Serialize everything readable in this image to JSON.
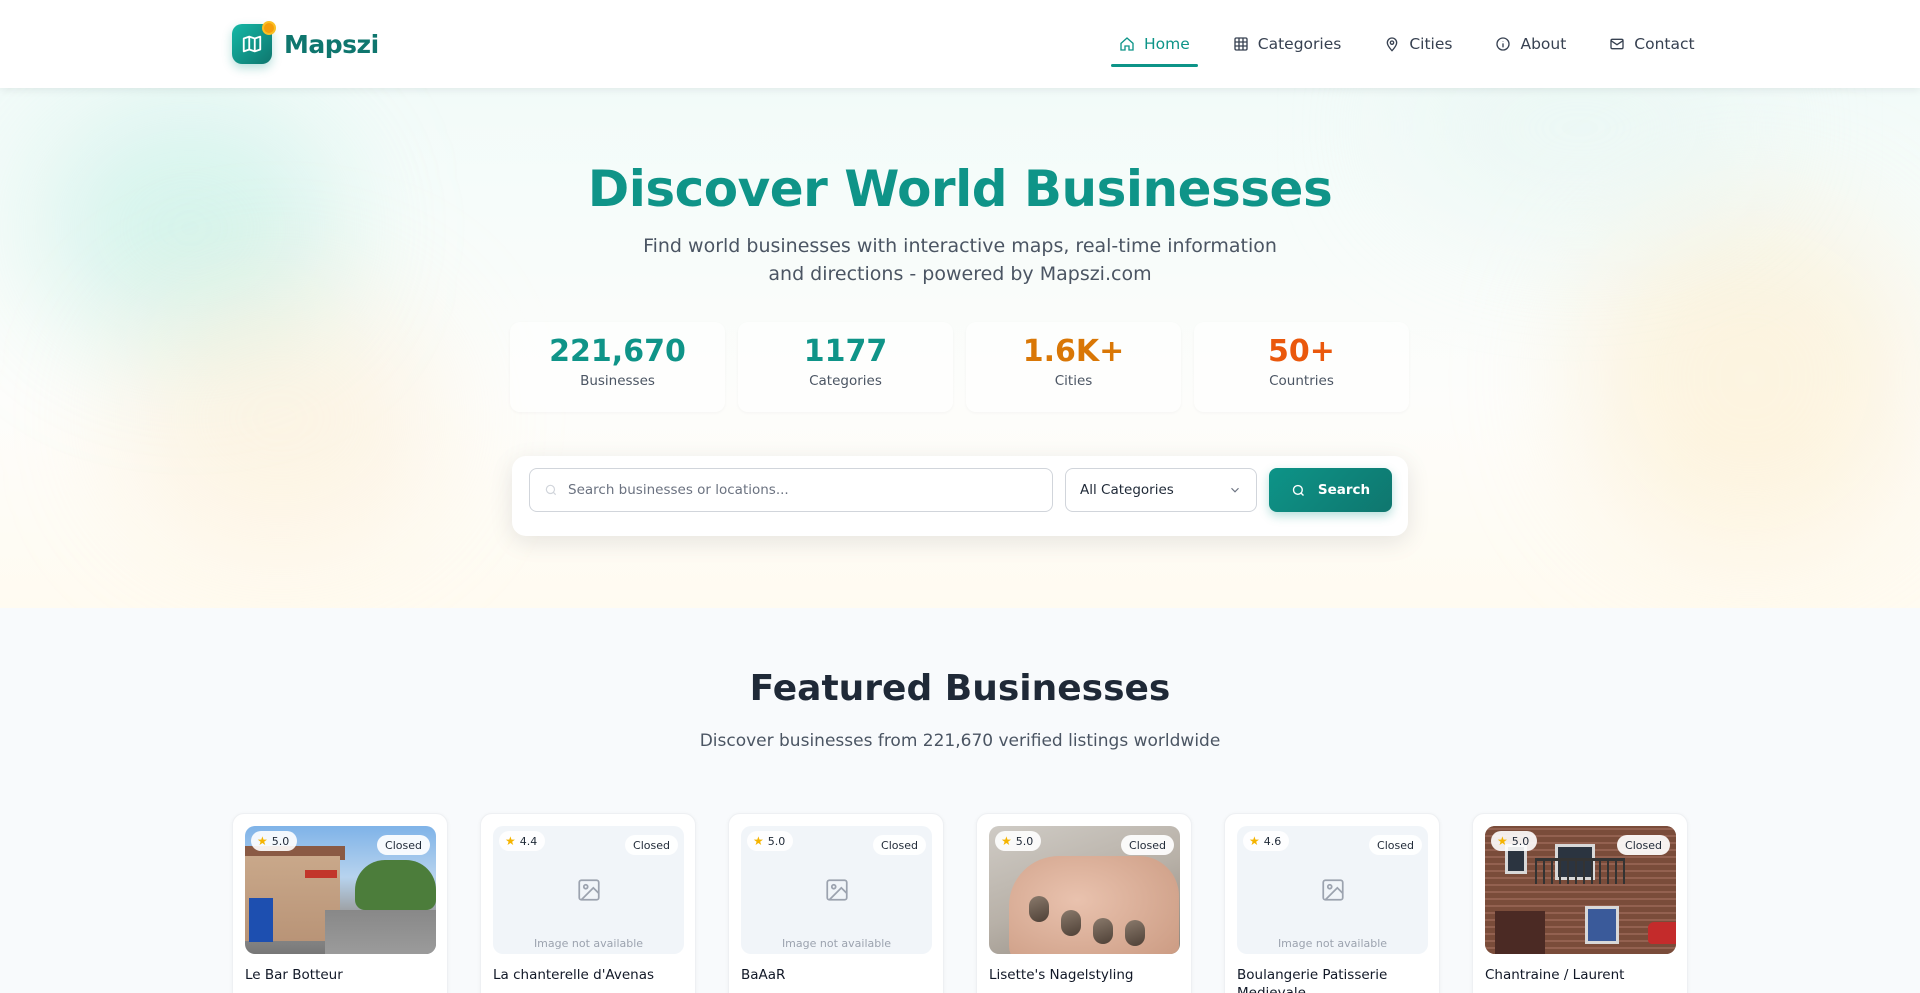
{
  "app": {
    "name": "Mapszi"
  },
  "nav": [
    {
      "label": "Home",
      "icon": "home-icon",
      "active": true
    },
    {
      "label": "Categories",
      "icon": "grid-icon",
      "active": false
    },
    {
      "label": "Cities",
      "icon": "map-pin-icon",
      "active": false
    },
    {
      "label": "About",
      "icon": "info-icon",
      "active": false
    },
    {
      "label": "Contact",
      "icon": "mail-icon",
      "active": false
    }
  ],
  "hero": {
    "title": "Discover World Businesses",
    "subtitle": "Find world businesses with interactive maps, real-time information and directions - powered by Mapszi.com"
  },
  "stats": [
    {
      "value": "221,670",
      "label": "Businesses",
      "color": "#0f9488"
    },
    {
      "value": "1177",
      "label": "Categories",
      "color": "#0f9488"
    },
    {
      "value": "1.6K+",
      "label": "Cities",
      "color": "#d97706"
    },
    {
      "value": "50+",
      "label": "Countries",
      "color": "#ea580c"
    }
  ],
  "search": {
    "placeholder": "Search businesses or locations...",
    "category_selected": "All Categories",
    "button_label": "Search"
  },
  "featured": {
    "title": "Featured Businesses",
    "subtitle": "Discover businesses from 221,670 verified listings worldwide",
    "no_image_label": "Image not available",
    "cards": [
      {
        "name": "Le Bar Botteur",
        "rating": "5.0",
        "status": "Closed",
        "has_image": true
      },
      {
        "name": "La chanterelle d'Avenas",
        "rating": "4.4",
        "status": "Closed",
        "has_image": false
      },
      {
        "name": "BaAaR",
        "rating": "5.0",
        "status": "Closed",
        "has_image": false
      },
      {
        "name": "Lisette's Nagelstyling",
        "rating": "5.0",
        "status": "Closed",
        "has_image": true
      },
      {
        "name": "Boulangerie Patisserie Medievale",
        "rating": "4.6",
        "status": "Closed",
        "has_image": false
      },
      {
        "name": "Chantraine / Laurent",
        "rating": "5.0",
        "status": "Closed",
        "has_image": true
      }
    ]
  },
  "colors": {
    "brand": "#0d9488",
    "accent": "#f59e0b"
  }
}
